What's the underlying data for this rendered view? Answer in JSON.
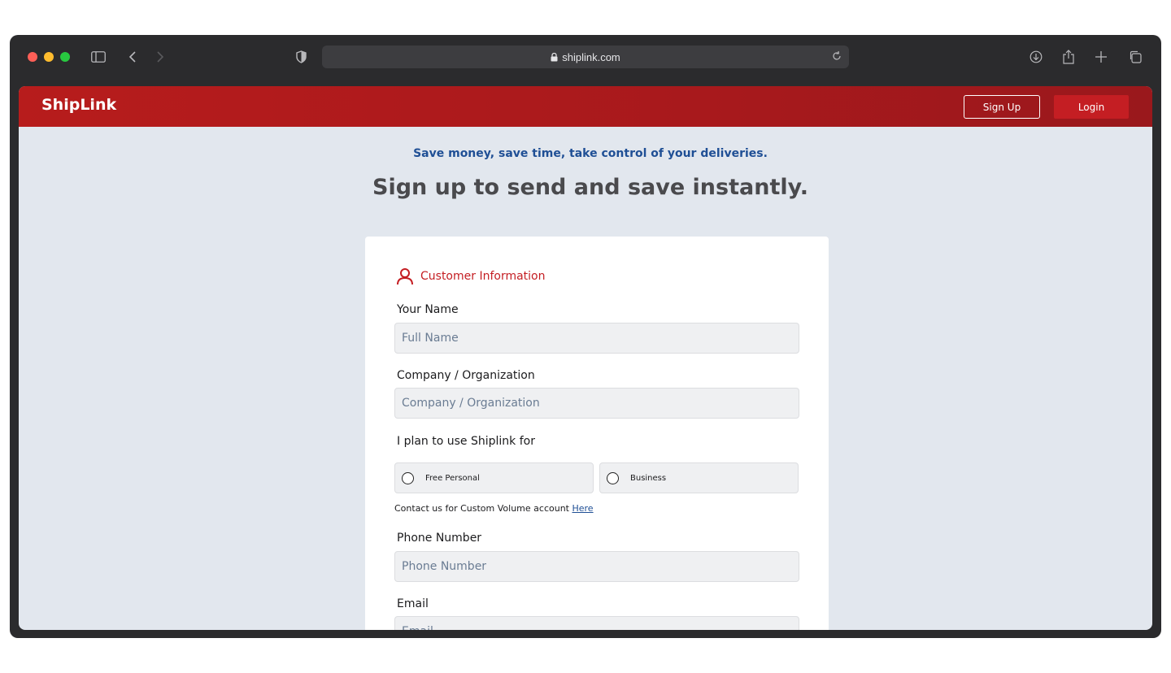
{
  "browser": {
    "url": "shiplink.com",
    "icons": {
      "sidebar": "sidebar-icon",
      "back": "chevron-left-icon",
      "forward": "chevron-right-icon",
      "privacy": "shield-icon",
      "lock": "lock-icon",
      "reload": "reload-icon",
      "downloads": "download-icon",
      "share": "share-icon",
      "new_tab": "plus-icon",
      "tabs": "tabs-overview-icon"
    },
    "colors": {
      "close": "#ff5f57",
      "minimize": "#febc2e",
      "maximize": "#28c840"
    }
  },
  "header": {
    "brand": "ShipLink",
    "signup_label": "Sign Up",
    "login_label": "Login",
    "colors": {
      "bar": "#b71c1c",
      "login_bg": "#c41e23"
    }
  },
  "hero": {
    "tagline": "Save money, save time, take control of your deliveries.",
    "headline": "Sign up to send and save instantly."
  },
  "form": {
    "section_title": "Customer Information",
    "section_icon": "user-icon",
    "name": {
      "label": "Your Name",
      "placeholder": "Full Name"
    },
    "company": {
      "label": "Company / Organization",
      "placeholder": "Company / Organization"
    },
    "usage": {
      "label": "I plan to use Shiplink for",
      "options": [
        {
          "label": "Free Personal"
        },
        {
          "label": "Business"
        }
      ]
    },
    "contact": {
      "text": "Contact us for Custom Volume account ",
      "link": "Here"
    },
    "phone": {
      "label": "Phone Number",
      "placeholder": "Phone Number"
    },
    "email": {
      "label": "Email",
      "placeholder": "Email"
    }
  },
  "colors": {
    "page_bg": "#e2e7ee",
    "accent_red": "#c41e23",
    "tagline_blue": "#1f4f95"
  }
}
